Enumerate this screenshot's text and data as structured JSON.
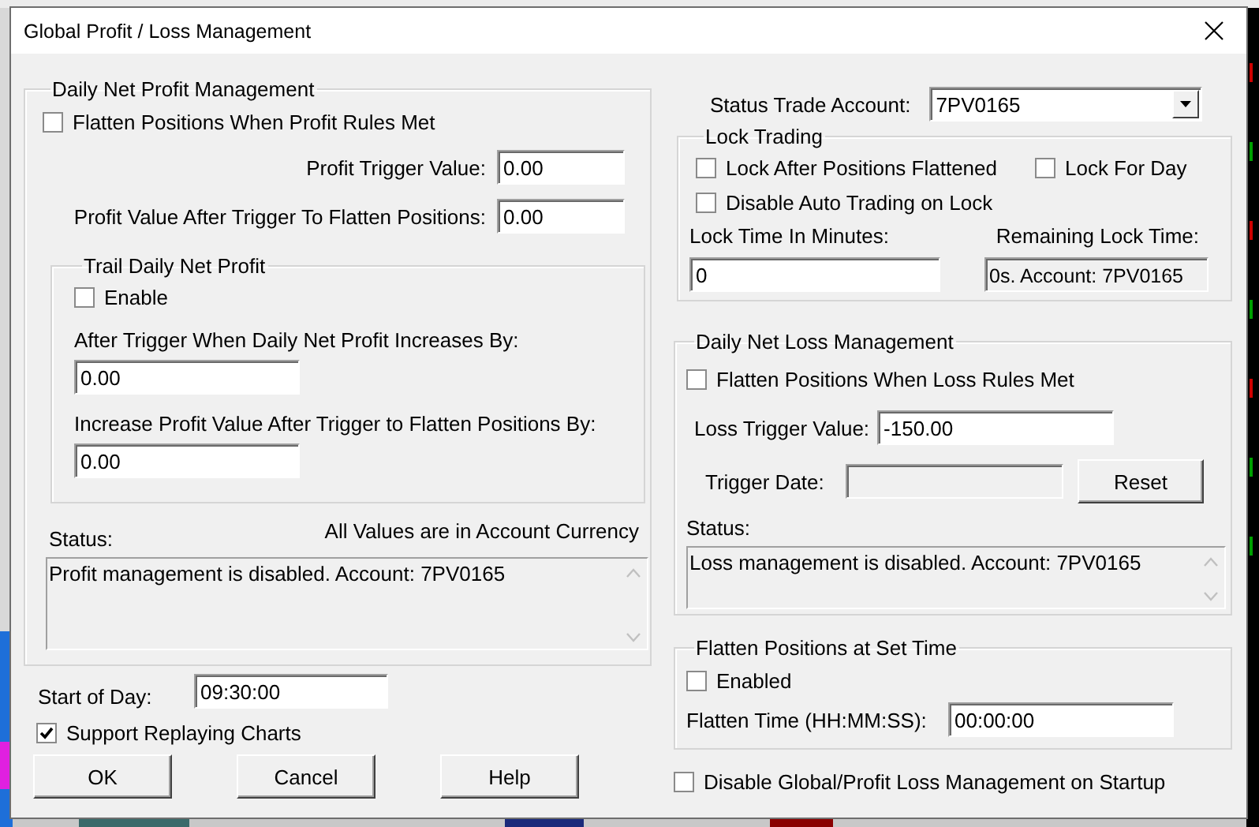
{
  "window": {
    "title": "Global Profit / Loss Management"
  },
  "profit": {
    "title": "Daily Net Profit Management",
    "flatten": {
      "label": "Flatten Positions When Profit Rules Met",
      "checked": false
    },
    "trigger": {
      "label": "Profit Trigger Value:",
      "value": "0.00"
    },
    "after_trigger": {
      "label": "Profit Value After Trigger To Flatten Positions:",
      "value": "0.00"
    },
    "trail": {
      "title": "Trail Daily Net Profit",
      "enable": {
        "label": "Enable",
        "checked": false
      },
      "increases": {
        "label": "After Trigger When Daily Net Profit Increases By:",
        "value": "0.00"
      },
      "increase_value": {
        "label": "Increase Profit Value After Trigger to Flatten Positions By:",
        "value": "0.00"
      }
    },
    "status_label": "Status:",
    "currency_note": "All Values are in Account Currency",
    "status_text": "Profit management is disabled. Account: 7PV0165"
  },
  "start_of_day": {
    "label": "Start of Day:",
    "value": "09:30:00"
  },
  "support_replaying": {
    "label": "Support Replaying Charts",
    "checked": true
  },
  "buttons": [
    "OK",
    "Cancel",
    "Help"
  ],
  "status_account": {
    "label": "Status Trade Account:",
    "value": "7PV0165"
  },
  "lock": {
    "title": "Lock Trading",
    "options": [
      {
        "label": "Lock After Positions Flattened",
        "checked": false
      },
      {
        "label": "Lock For Day",
        "checked": false
      },
      {
        "label": "Disable Auto Trading on Lock",
        "checked": false
      }
    ],
    "minutes": {
      "label": "Lock Time In Minutes:",
      "value": "0"
    },
    "remaining": {
      "label": "Remaining Lock Time:",
      "value": "0s. Account: 7PV0165",
      "disabled": true
    }
  },
  "loss": {
    "title": "Daily Net Loss Management",
    "flatten": {
      "label": "Flatten Positions When Loss Rules Met",
      "checked": false
    },
    "trigger": {
      "label": "Loss Trigger Value:",
      "value": "-150.00"
    },
    "trigger_date": {
      "label": "Trigger Date:",
      "disabled": true
    },
    "reset": "Reset",
    "status_label": "Status:",
    "status_text": "Loss management is disabled. Account: 7PV0165"
  },
  "set_time": {
    "title": "Flatten Positions at Set Time",
    "enabled": {
      "label": "Enabled",
      "checked": false
    },
    "time": {
      "label": "Flatten Time (HH:MM:SS):",
      "value": "00:00:00"
    }
  },
  "disable_on_startup": {
    "label": "Disable Global/Profit Loss Management on Startup",
    "checked": false
  }
}
